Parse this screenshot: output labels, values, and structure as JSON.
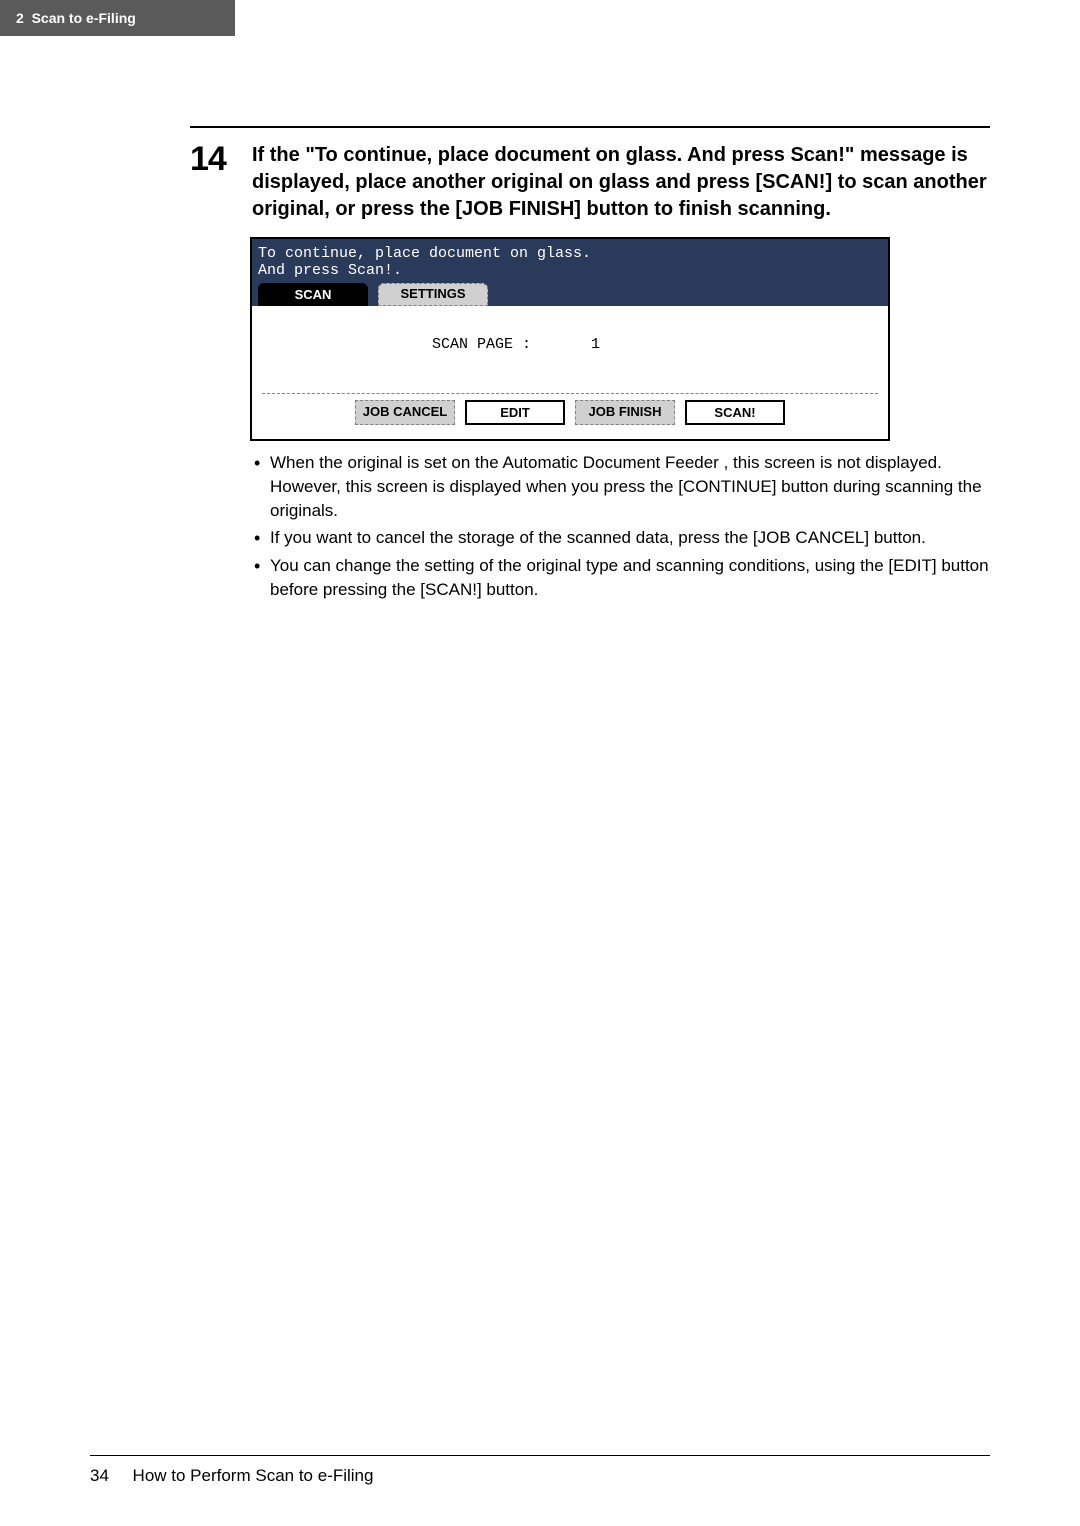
{
  "header": {
    "chapter_number": "2",
    "chapter_title": "Scan to e-Filing"
  },
  "step": {
    "number": "14",
    "text": "If the \"To continue, place document on glass.  And press Scan!\" message is displayed, place another original on glass and press [SCAN!] to scan another original, or press the [JOB FINISH] button to finish scanning."
  },
  "screenshot": {
    "msg_line1": "To continue, place document on glass.",
    "msg_line2": "And press Scan!.",
    "tab_scan": "SCAN",
    "tab_settings": "SETTINGS",
    "scan_page_label": "SCAN PAGE :",
    "scan_page_value": "1",
    "btn_job_cancel": "JOB CANCEL",
    "btn_edit": "EDIT",
    "btn_job_finish": "JOB FINISH",
    "btn_scan": "SCAN!"
  },
  "bullets": [
    "When the original is set on the Automatic Document Feeder , this screen is not displayed.  However, this screen is displayed when you press the [CONTINUE] button during scanning the originals.",
    "If you want to cancel the storage of the scanned data, press the [JOB CANCEL] button.",
    "You can change the setting of the original type and scanning conditions, using the [EDIT] button before pressing the [SCAN!] button."
  ],
  "footer": {
    "page": "34",
    "title": "How to Perform Scan to e-Filing"
  }
}
